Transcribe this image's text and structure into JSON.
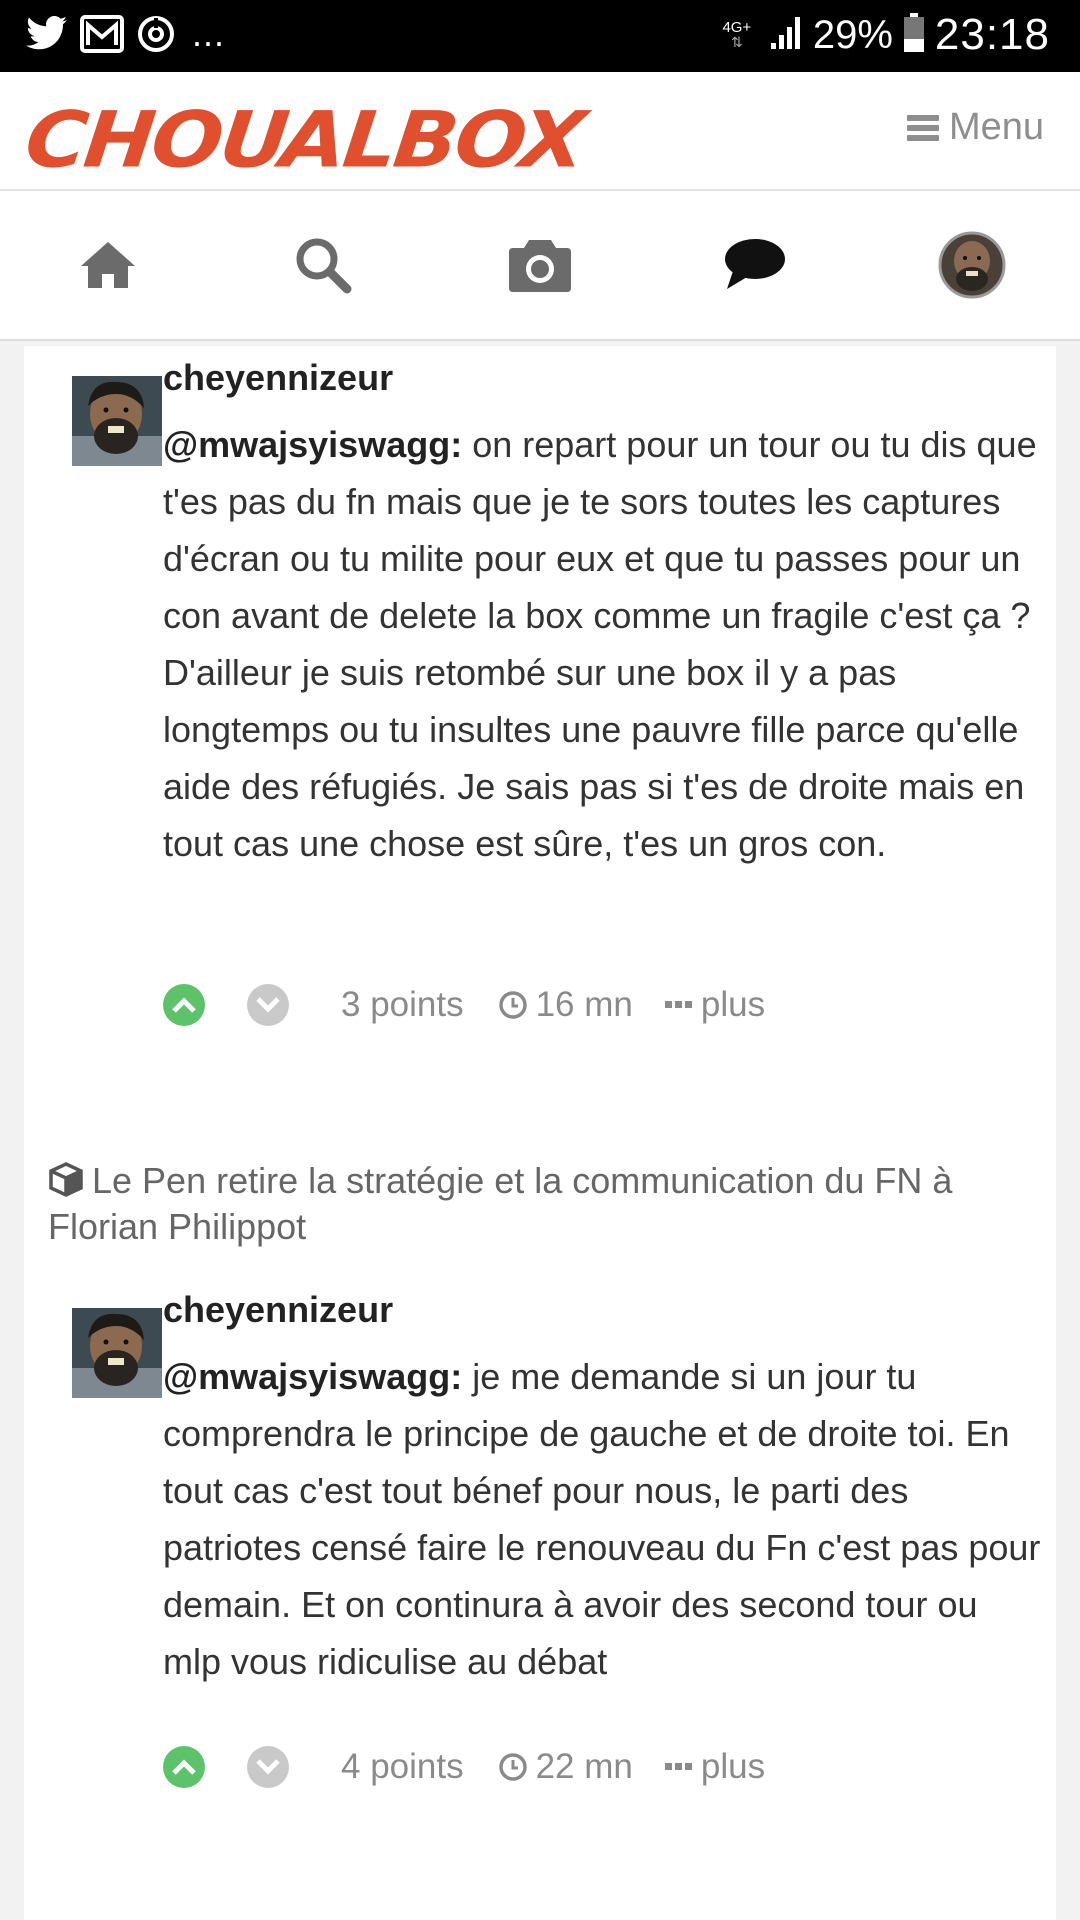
{
  "status_bar": {
    "overflow": "...",
    "network": "4G+",
    "battery": "29%",
    "time": "23:18",
    "icons": [
      "twitter-icon",
      "mail-icon",
      "sync-icon",
      "signal-icon",
      "battery-icon"
    ]
  },
  "header": {
    "logo": "CHOUALBOX",
    "menu_label": "Menu"
  },
  "nav": {
    "items": [
      "home-icon",
      "search-icon",
      "camera-icon",
      "chat-icon",
      "avatar"
    ]
  },
  "colors": {
    "brand": "#e0502e",
    "upvote": "#5cc36a",
    "downvote": "#c9c9c9",
    "text": "#333333",
    "muted": "#8a8a8a"
  },
  "comments": [
    {
      "author": "cheyennizeur",
      "mention": "@mwajsyiswagg:",
      "text": " on repart pour un tour ou tu dis que t'es pas du fn mais que je te sors toutes les captures d'écran ou tu milite pour eux et que tu passes pour un con avant de delete la box comme un fragile c'est ça ? D'ailleur je suis retombé sur une box il y a pas longtemps ou tu insultes une pauvre fille parce qu'elle aide des réfugiés. Je sais pas si t'es de droite mais en tout cas une chose est sûre, t'es un gros con.",
      "points": "3 points",
      "time": "16 mn",
      "more": "plus"
    },
    {
      "box_title": "Le Pen retire la stratégie et la communication du FN à Florian Philippot",
      "author": "cheyennizeur",
      "mention": "@mwajsyiswagg:",
      "text": " je me demande si un jour tu comprendra le principe de gauche et de droite toi. En tout cas c'est tout bénef pour nous, le parti des patriotes censé faire le renouveau du Fn c'est pas pour demain. Et on continura à avoir des second tour ou mlp vous ridiculise au débat",
      "points": "4 points",
      "time": "22 mn",
      "more": "plus"
    }
  ]
}
